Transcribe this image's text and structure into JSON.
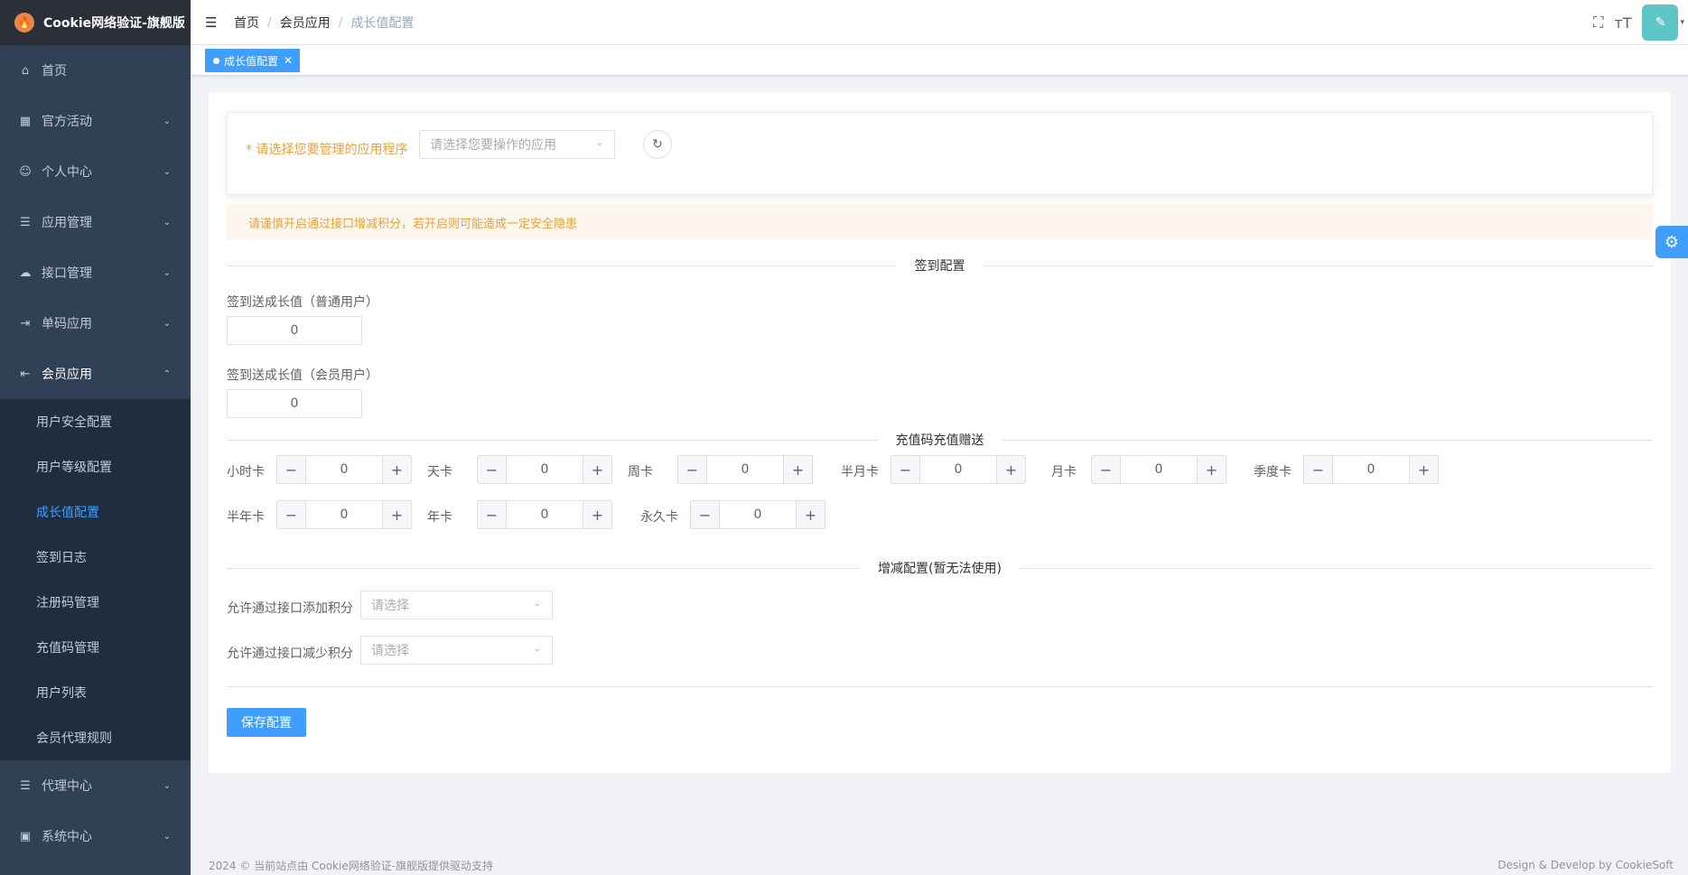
{
  "app": {
    "title": "Cookie网络验证-旗舰版",
    "logo_glyph": "🔥"
  },
  "sidebar": {
    "items": [
      {
        "label": "首页",
        "icon": "home-icon",
        "glyph": "⌂"
      },
      {
        "label": "官方活动",
        "icon": "grid-icon",
        "glyph": "▦"
      },
      {
        "label": "个人中心",
        "icon": "user-icon",
        "glyph": "☺"
      },
      {
        "label": "应用管理",
        "icon": "list-tree-icon",
        "glyph": "☰"
      },
      {
        "label": "接口管理",
        "icon": "cloud-icon",
        "glyph": "☁"
      },
      {
        "label": "单码应用",
        "icon": "login-arrow-icon",
        "glyph": "⇥"
      },
      {
        "label": "会员应用",
        "icon": "back-arrow-icon",
        "glyph": "⇤"
      }
    ],
    "sub_items": [
      "用户安全配置",
      "用户等级配置",
      "成长值配置",
      "签到日志",
      "注册码管理",
      "充值码管理",
      "用户列表",
      "会员代理规则"
    ],
    "bottom_items": [
      {
        "label": "代理中心",
        "icon": "list-tree-icon",
        "glyph": "☰"
      },
      {
        "label": "系统中心",
        "icon": "monitor-icon",
        "glyph": "▣"
      }
    ]
  },
  "navbar": {
    "breadcrumb": [
      "首页",
      "会员应用",
      "成长值配置"
    ],
    "sep": "/",
    "hamburger": "☰",
    "fullscreen": "⛶",
    "font_size": "тT",
    "avatar_glyph": "✎",
    "caret": "▾"
  },
  "tags": {
    "active": "成长值配置",
    "close": "✕"
  },
  "form": {
    "app_select_label": "* 请选择您要管理的应用程序",
    "app_select_placeholder": "请选择您要操作的应用",
    "refresh_glyph": "↻",
    "alert": "请谨慎开启通过接口增减积分，若开启则可能造成一定安全隐患",
    "sign_section": "签到配置",
    "sign_normal_label": "签到送成长值（普通用户）",
    "sign_normal_value": "0",
    "sign_vip_label": "签到送成长值（会员用户）",
    "sign_vip_value": "0",
    "recharge_section": "充值码充值赠送",
    "cards_row1": [
      {
        "label": "小时卡",
        "value": "0"
      },
      {
        "label": "天卡",
        "value": "0"
      },
      {
        "label": "周卡",
        "value": "0"
      },
      {
        "label": "半月卡",
        "value": "0"
      },
      {
        "label": "月卡",
        "value": "0"
      },
      {
        "label": "季度卡",
        "value": "0"
      }
    ],
    "cards_row2": [
      {
        "label": "半年卡",
        "value": "0"
      },
      {
        "label": "年卡",
        "value": "0"
      },
      {
        "label": "永久卡",
        "value": "0"
      }
    ],
    "minus": "−",
    "plus": "+",
    "adjust_section": "增减配置(暂无法使用)",
    "allow_add_label": "允许通过接口添加积分",
    "allow_sub_label": "允许通过接口减少积分",
    "select_placeholder": "请选择",
    "save": "保存配置"
  },
  "footer": {
    "left": "2024 © 当前站点由 Cookie网络验证-旗舰版提供驱动支持",
    "right": "Design & Develop by CookieSoft"
  },
  "settings_glyph": "⚙",
  "arrow_down": "⌄",
  "arrow_up": "⌃",
  "accent": "#409eff"
}
